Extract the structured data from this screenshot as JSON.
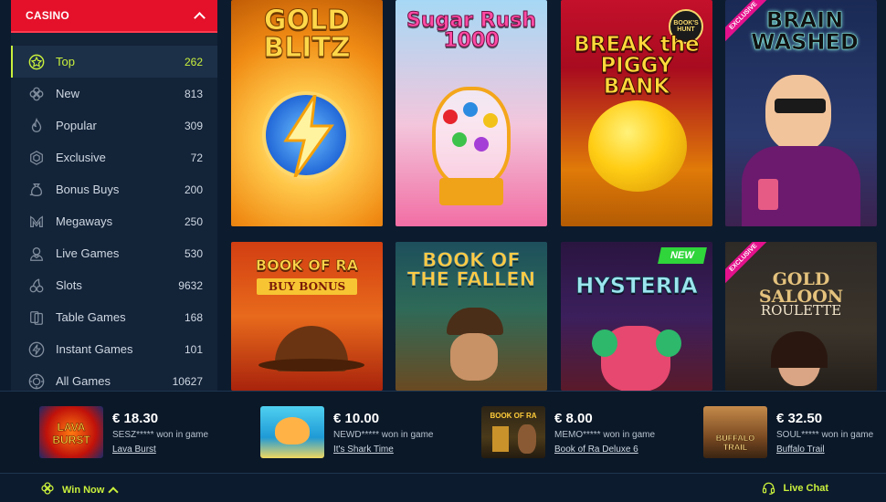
{
  "sidebar": {
    "title": "CASINO",
    "items": [
      {
        "label": "Top",
        "count": "262",
        "icon": "star-badge-icon"
      },
      {
        "label": "New",
        "count": "813",
        "icon": "clover-icon"
      },
      {
        "label": "Popular",
        "count": "309",
        "icon": "flame-icon"
      },
      {
        "label": "Exclusive",
        "count": "72",
        "icon": "gem-icon"
      },
      {
        "label": "Bonus Buys",
        "count": "200",
        "icon": "money-bag-icon"
      },
      {
        "label": "Megaways",
        "count": "250",
        "icon": "megaways-icon"
      },
      {
        "label": "Live Games",
        "count": "530",
        "icon": "dealer-icon"
      },
      {
        "label": "Slots",
        "count": "9632",
        "icon": "cherries-icon"
      },
      {
        "label": "Table Games",
        "count": "168",
        "icon": "cards-icon"
      },
      {
        "label": "Instant Games",
        "count": "101",
        "icon": "lightning-icon"
      },
      {
        "label": "All Games",
        "count": "10627",
        "icon": "chip-icon"
      }
    ]
  },
  "games": [
    {
      "name": "GOLD BLITZ"
    },
    {
      "name": "Sugar Rush 1000"
    },
    {
      "name": "BREAK the PIGGY BANK",
      "badge": "BOOK'S HUNT"
    },
    {
      "name": "BRAIN WASHED",
      "ribbon": "EXCLUSIVE"
    },
    {
      "name": "BOOK OF RA",
      "subtitle": "BUY BONUS"
    },
    {
      "name": "BOOK OF THE FALLEN"
    },
    {
      "name": "HYSTERIA",
      "badge": "NEW"
    },
    {
      "name": "GOLD SALOON",
      "subtitle": "ROULETTE",
      "ribbon": "EXCLUSIVE"
    }
  ],
  "winners": [
    {
      "amount": "€ 18.30",
      "who": "SESZ***** won in game",
      "game": "Lava Burst",
      "thumb": "LAVA BURST"
    },
    {
      "amount": "€ 10.00",
      "who": "NEWD***** won in game",
      "game": "It's Shark Time",
      "thumb": ""
    },
    {
      "amount": "€ 8.00",
      "who": "MEMO***** won in game",
      "game": "Book of Ra Deluxe 6",
      "thumb": "BOOK OF RA"
    },
    {
      "amount": "€ 32.50",
      "who": "SOUL***** won in game",
      "game": "Buffalo Trail",
      "thumb": "BUFFALO TRAIL"
    }
  ],
  "bottombar": {
    "win_now": "Win Now",
    "live_chat": "Live Chat"
  },
  "colors": {
    "accent": "#c9f03c",
    "brand_red": "#e5112a",
    "background": "#0d1b2e",
    "sidebar": "#132338"
  }
}
